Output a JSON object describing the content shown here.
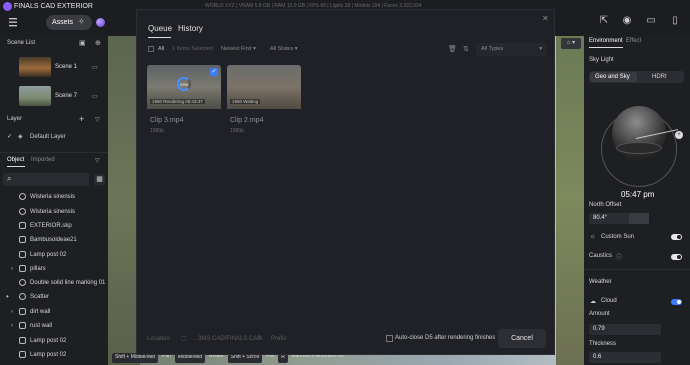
{
  "app": {
    "title": "FINALS CAD EXTERIOR",
    "assets_label": "Assets"
  },
  "stats": "WORLD XYZ  |  VRAM 6.8 GB  |  RAM 12.0 GB  |  FPS 60  |  Lights 28  |  Models 104  |  Faces 2,322,934",
  "left_panel": {
    "scene_list_title": "Scene List",
    "scenes": [
      {
        "label": "Scene 1"
      },
      {
        "label": "Scene 7"
      }
    ],
    "layer_title": "Layer",
    "layers": [
      {
        "label": "Default Layer"
      }
    ],
    "object_tab": "Object",
    "imported_tab": "Imported",
    "search_placeholder": "",
    "objects": [
      {
        "label": "Wisteria sinensis"
      },
      {
        "label": "Wisteria sinensis"
      },
      {
        "label": "EXTERIOR.skp"
      },
      {
        "label": "Bambusoideae21"
      },
      {
        "label": "Lamp post 02"
      },
      {
        "label": "pillars"
      },
      {
        "label": "Double solid line marking 01"
      },
      {
        "label": "Scatter"
      },
      {
        "label": "dirt wall"
      },
      {
        "label": "rust wall"
      },
      {
        "label": "Lamp post 02"
      },
      {
        "label": "Lamp post 02"
      }
    ]
  },
  "modal": {
    "tab_queue": "Queue",
    "tab_history": "History",
    "toolbar": {
      "all_label": "All",
      "items_selected": "1 Items Selected",
      "sort": "Newest First",
      "states": "All States",
      "types": "All Types"
    },
    "clips": [
      {
        "title": "Clip 3.mp4",
        "sub": "1080p",
        "badge": "1980  Rendering 05:43:47",
        "progress": "29%"
      },
      {
        "title": "Clip 2.mp4",
        "sub": "1080p",
        "badge": "1980  Waiting"
      }
    ],
    "footer": {
      "location_label": "Location",
      "location_value": "...3MS CAD\\FINALS CAD",
      "prefix_label": "Prefix",
      "autoclose_label": "Auto-close D5 after rendering finishes",
      "cancel_label": "Cancel"
    }
  },
  "bottom_help": [
    "Shift + Middle/Mid",
    "Pan",
    "Middle/Mid",
    "Rotate",
    "Shift + Scroll",
    "Fov",
    "R",
    "Random Placement Off"
  ],
  "right_panel": {
    "tab_environment": "Environment",
    "tab_effect": "Effect",
    "sky_light_title": "Sky Light",
    "geo_and_sky": "Geo and Sky",
    "hdri": "HDRI",
    "time": "05:47 pm",
    "north_offset_label": "North Offset",
    "north_offset_value": "80.4°",
    "custom_sun_label": "Custom Sun",
    "caustics_label": "Caustics",
    "weather_title": "Weather",
    "cloud_label": "Cloud",
    "amount_label": "Amount",
    "amount_value": "0.79",
    "thickness_label": "Thickness",
    "thickness_value": "0.6"
  },
  "colors": {
    "accent": "#3d7bff",
    "logo": "#8a5cf6"
  }
}
